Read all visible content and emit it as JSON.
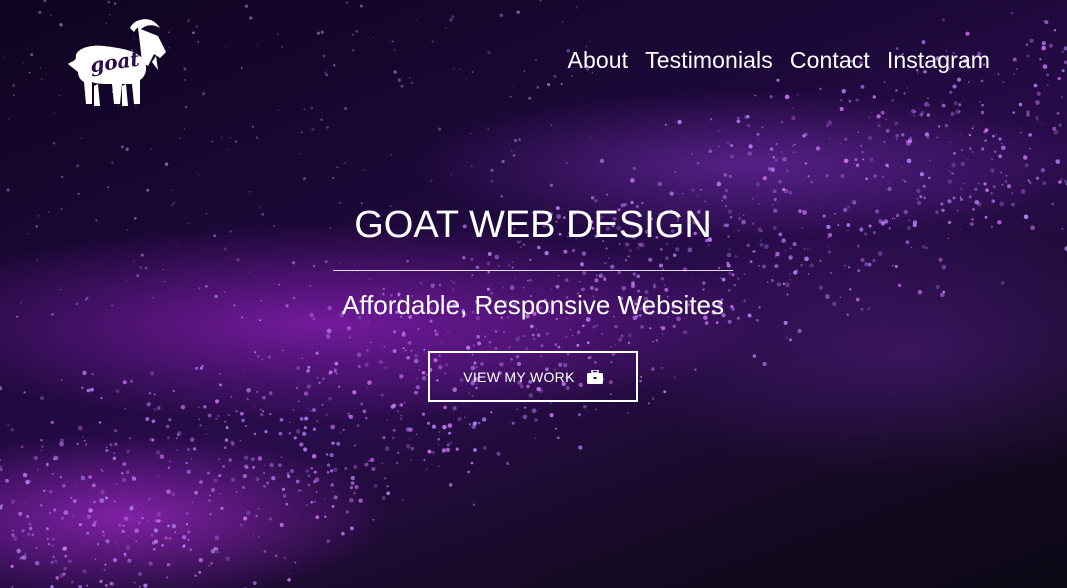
{
  "brand": {
    "logo_text": "goat",
    "logo_icon": "goat-icon"
  },
  "nav": {
    "items": [
      {
        "label": "About"
      },
      {
        "label": "Testimonials"
      },
      {
        "label": "Contact"
      },
      {
        "label": "Instagram"
      }
    ]
  },
  "hero": {
    "title": "GOAT WEB DESIGN",
    "subtitle": "Affordable, Responsive Websites",
    "cta_label": "VIEW MY WORK",
    "cta_icon": "briefcase-icon"
  },
  "colors": {
    "accent": "#b03cf0",
    "text": "#ffffff",
    "background": "#12081f"
  }
}
